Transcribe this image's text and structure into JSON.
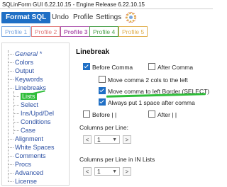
{
  "window": {
    "title": "SQLinForm GUI 6.22.10.15 - Engine Release 6.22.10.15"
  },
  "menu": {
    "format_label": "Format SQL",
    "undo_label": "Undo",
    "profile_label": "Profile",
    "settings_label": "Settings",
    "settings_icon": "gear-icon"
  },
  "tabs": [
    {
      "label": "Profile 1",
      "color": "#7aa7e0"
    },
    {
      "label": "Profile 2",
      "color": "#e07a7a"
    },
    {
      "label": "Profile 3",
      "color": "#b05ab0"
    },
    {
      "label": "Profile 4",
      "color": "#4aa04a"
    },
    {
      "label": "Profile 5",
      "color": "#e0b050"
    }
  ],
  "tree": {
    "items": [
      {
        "label": "General *"
      },
      {
        "label": "Colors"
      },
      {
        "label": "Output"
      },
      {
        "label": "Keywords"
      },
      {
        "label": "Linebreaks"
      },
      {
        "label": "Lists"
      },
      {
        "label": "Select"
      },
      {
        "label": "Ins/Upd/Del"
      },
      {
        "label": "Conditions"
      },
      {
        "label": "Case"
      },
      {
        "label": "Alignment"
      },
      {
        "label": "White Spaces"
      },
      {
        "label": "Comments"
      },
      {
        "label": "Procs"
      },
      {
        "label": "Advanced"
      },
      {
        "label": "License"
      }
    ],
    "selected": "Lists"
  },
  "linebreak": {
    "title": "Linebreak",
    "before_comma": {
      "label": "Before Comma",
      "checked": true
    },
    "after_comma": {
      "label": "After Comma",
      "checked": false
    },
    "move_comma_2_cols": {
      "label": "Move comma 2 cols to the left",
      "checked": false
    },
    "move_comma_left_border": {
      "label": "Move comma to left Border (SELECT)",
      "checked": true
    },
    "always_space_after_comma": {
      "label": "Always put 1 space after comma",
      "checked": true
    },
    "before_pipe": {
      "label": "Before | |",
      "checked": false
    },
    "after_pipe": {
      "label": "After | |",
      "checked": false
    }
  },
  "columns_per_line": {
    "label": "Columns per Line:",
    "value": "1"
  },
  "columns_per_line_in_lists": {
    "label": "Columns per Line in IN Lists",
    "value": "1"
  },
  "accent": "#1f6fc5",
  "highlight": "#2fbd3a"
}
